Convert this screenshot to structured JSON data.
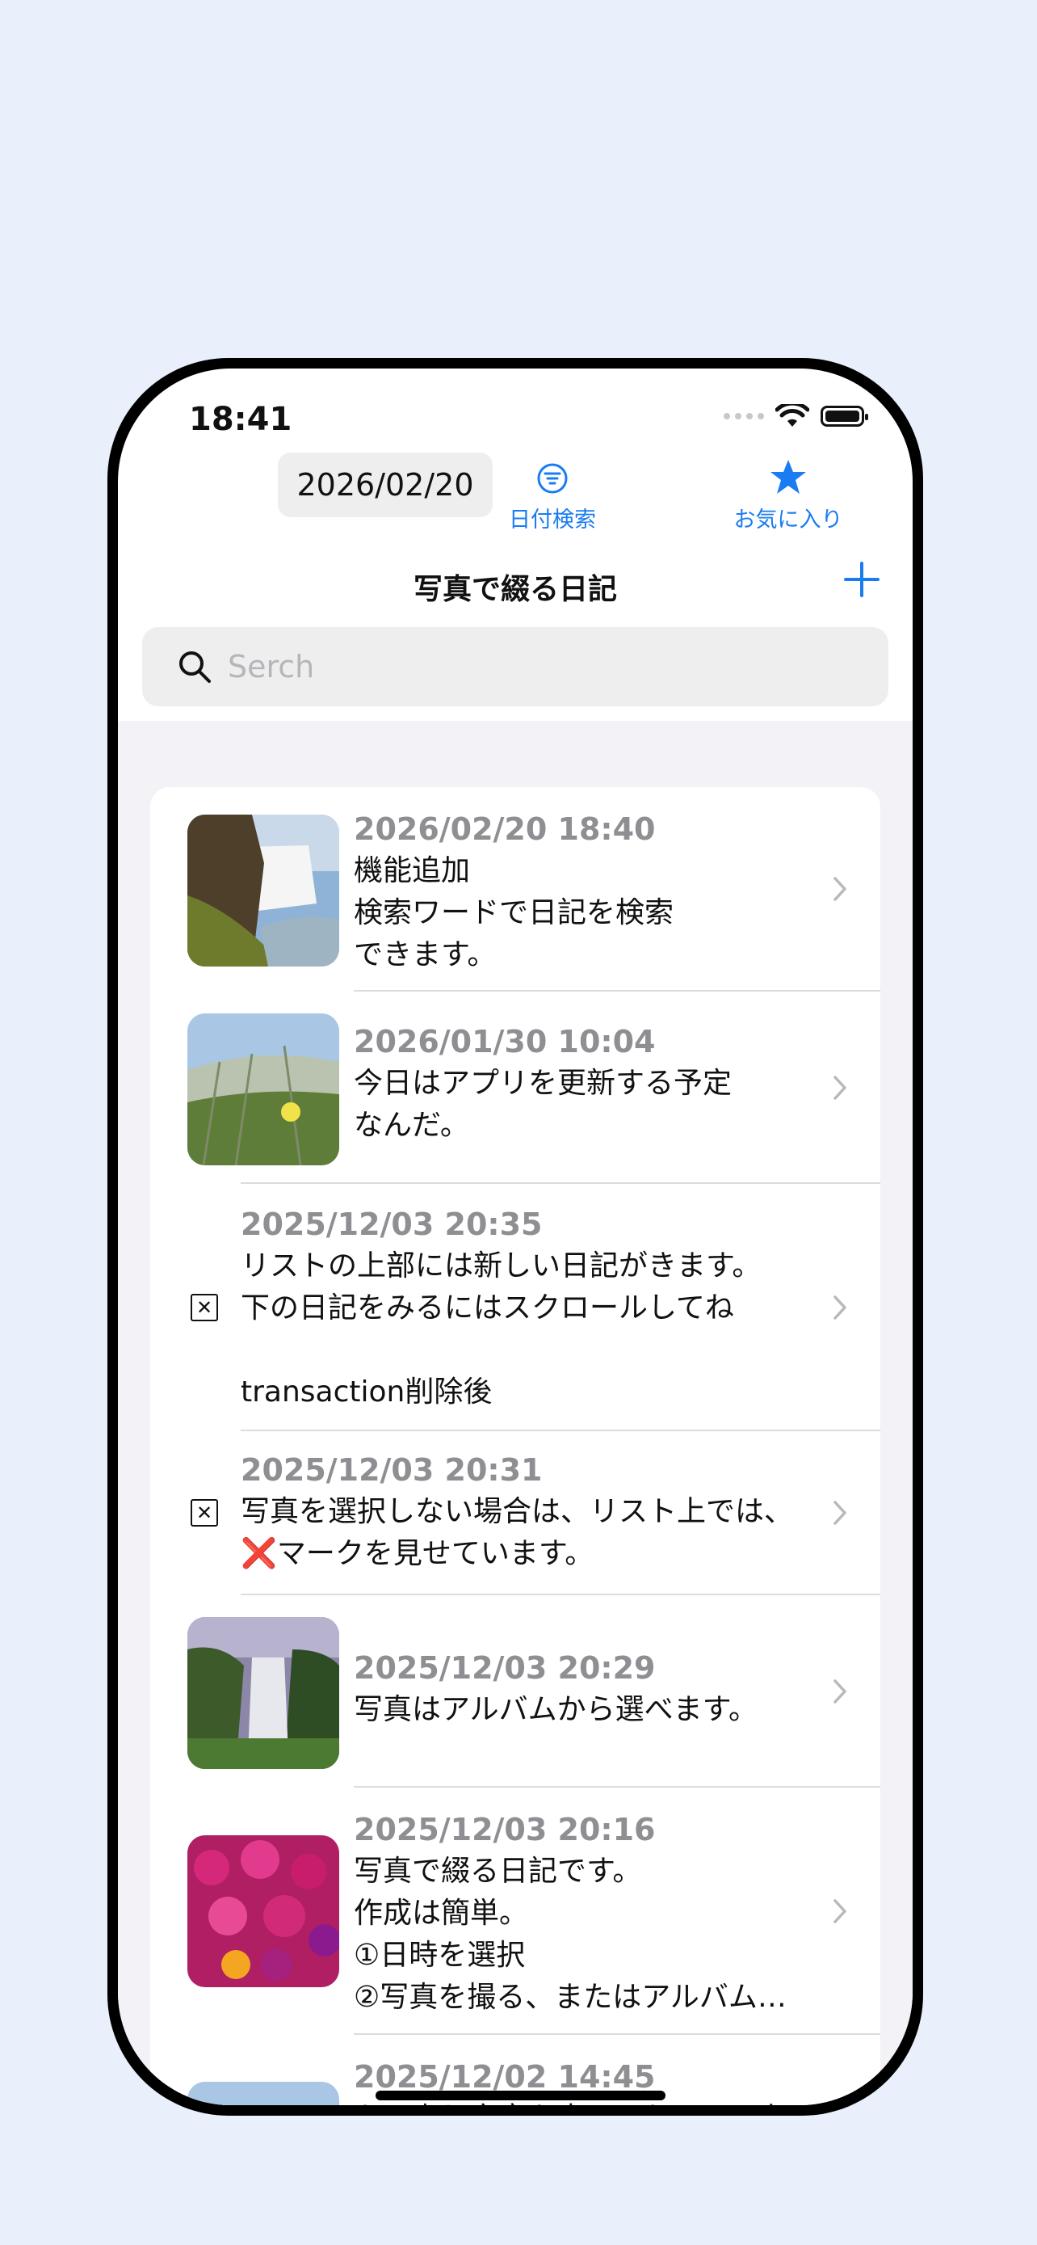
{
  "status_bar": {
    "time": "18:41"
  },
  "toolbar": {
    "date": "2026/02/20",
    "filter_label": "日付検索",
    "favorites_label": "お気に入り"
  },
  "nav": {
    "title": "写真で綴る日記",
    "add_icon": "plus-icon"
  },
  "search": {
    "placeholder": "Serch",
    "value": ""
  },
  "entries": [
    {
      "datetime": "2026/02/20 18:40",
      "text": "機能追加\n検索ワードで日記を検索\nできます。",
      "has_photo": true,
      "photo": "waterfall-landscape"
    },
    {
      "datetime": "2026/01/30 10:04",
      "text": "今日はアプリを更新する予定\nなんだ。",
      "has_photo": true,
      "photo": "dune-grass-flower"
    },
    {
      "datetime": "2025/12/03 20:35",
      "text": "リストの上部には新しい日記がきます。\n下の日記をみるにはスクロールしてね\n\ntransaction削除後",
      "has_photo": false,
      "placeholder_icon": "x-box-icon"
    },
    {
      "datetime": "2025/12/03 20:31",
      "text_line1": "写真を選択しない場合は、リスト上では、",
      "text_mark": "❌",
      "text_line2_rest": "マークを見せています。",
      "has_photo": false,
      "placeholder_icon": "x-box-icon"
    },
    {
      "datetime": "2025/12/03 20:29",
      "text": "写真はアルバムから選べます。",
      "has_photo": true,
      "photo": "tall-waterfall"
    },
    {
      "datetime": "2025/12/03 20:16",
      "text": "写真で綴る日記です。\n作成は簡単。\n①日時を選択\n②写真を撮る、またはアルバム…",
      "has_photo": true,
      "photo": "pink-flowers"
    },
    {
      "datetime": "2025/12/02 14:45",
      "text": "もう少し文章を書いてもリスト上",
      "has_photo": true,
      "photo": "dune-grass-flower"
    }
  ]
}
